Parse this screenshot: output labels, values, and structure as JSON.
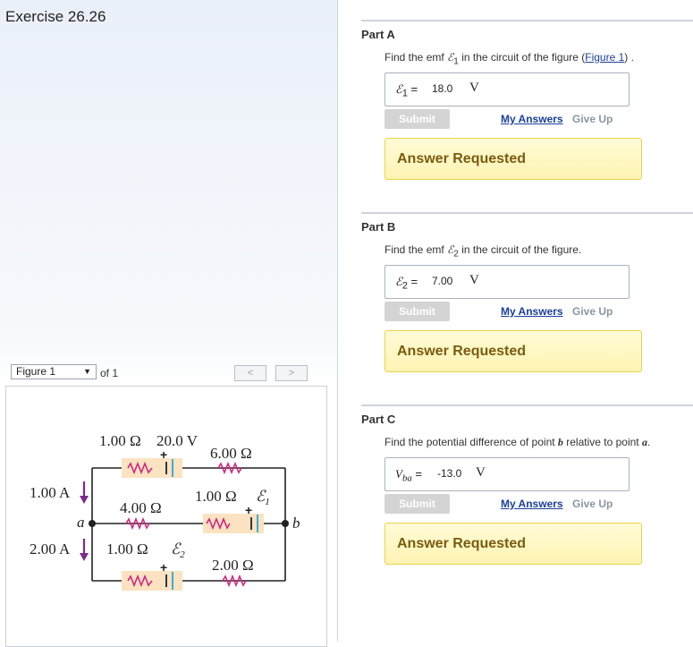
{
  "exercise_title": "Exercise 26.26",
  "figure_bar": {
    "selector": "Figure 1",
    "of_label": "of 1",
    "prev": "<",
    "next": ">"
  },
  "figure": {
    "r_top1": "1.00 Ω",
    "emf_top": "20.0 V",
    "r_top2": "6.00 Ω",
    "current_top": "1.00 A",
    "r_mid1": "4.00 Ω",
    "r_mid_int": "1.00 Ω",
    "emf_mid": "ℰ",
    "emf_mid_sub": "1",
    "node_a": "a",
    "node_b": "b",
    "current_bot": "2.00 A",
    "r_bot_int": "1.00 Ω",
    "emf_bot": "ℰ",
    "emf_bot_sub": "2",
    "r_bot2": "2.00 Ω",
    "plus": "+"
  },
  "parts": [
    {
      "title": "Part A",
      "q_pre": "Find the emf ",
      "q_sym": "ℰ",
      "q_sub": "1",
      "q_post": " in the circuit of the figure (",
      "q_link": "Figure 1",
      "q_end": ") .",
      "ans_sym": "ℰ",
      "ans_sub": "1",
      "ans_eq": " = ",
      "ans_value": "18.0",
      "ans_unit": "V",
      "submit": "Submit",
      "my_answers": "My Answers",
      "give_up": "Give Up",
      "status": "Answer Requested"
    },
    {
      "title": "Part B",
      "q_pre": "Find the emf ",
      "q_sym": "ℰ",
      "q_sub": "2",
      "q_post": " in the circuit of the figure.",
      "ans_sym": "ℰ",
      "ans_sub": "2",
      "ans_eq": " = ",
      "ans_value": "7.00",
      "ans_unit": "V",
      "submit": "Submit",
      "my_answers": "My Answers",
      "give_up": "Give Up",
      "status": "Answer Requested"
    },
    {
      "title": "Part C",
      "q_pre": "Find the potential difference of point ",
      "q_b": "b",
      "q_mid": " relative to point ",
      "q_a": "a",
      "q_end": ".",
      "ans_sym": "V",
      "ans_sub": "ba",
      "ans_eq": " = ",
      "ans_value": "-13.0",
      "ans_unit": "V",
      "submit": "Submit",
      "my_answers": "My Answers",
      "give_up": "Give Up",
      "status": "Answer Requested"
    }
  ]
}
